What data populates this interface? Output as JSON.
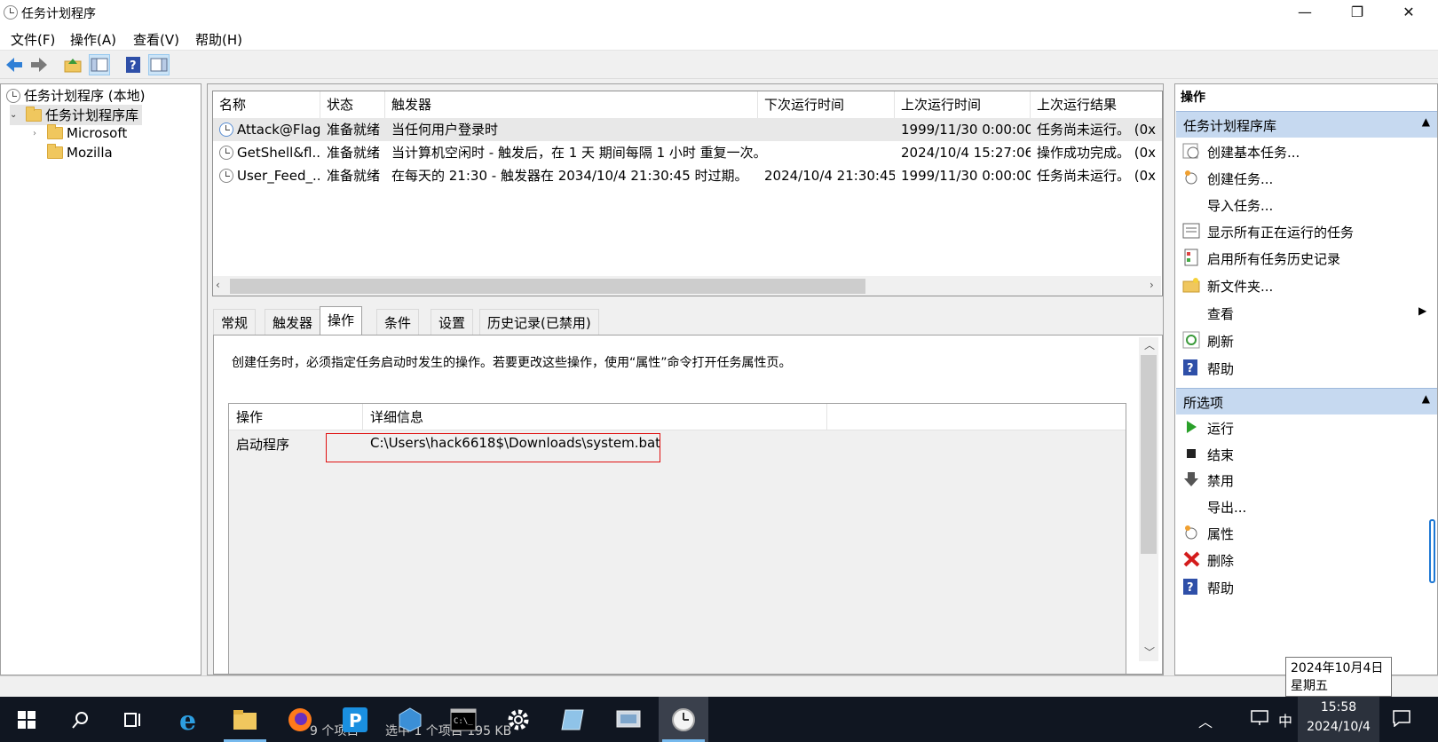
{
  "window": {
    "title": "任务计划程序",
    "minimize": "—",
    "maximize": "❐",
    "close": "✕"
  },
  "menu": [
    "文件(F)",
    "操作(A)",
    "查看(V)",
    "帮助(H)"
  ],
  "tree": {
    "root": "任务计划程序 (本地)",
    "library": "任务计划程序库",
    "children": [
      "Microsoft",
      "Mozilla"
    ]
  },
  "tasks": {
    "columns": [
      "名称",
      "状态",
      "触发器",
      "下次运行时间",
      "上次运行时间",
      "上次运行结果"
    ],
    "rows": [
      {
        "name": "Attack@Flag",
        "status": "准备就绪",
        "trigger": "当任何用户登录时",
        "next": "",
        "last": "1999/11/30 0:00:00",
        "result": "任务尚未运行。 (0x"
      },
      {
        "name": "GetShell&fl...",
        "status": "准备就绪",
        "trigger": "当计算机空闲时 - 触发后，在 1 天 期间每隔 1 小时 重复一次。",
        "next": "",
        "last": "2024/10/4 15:27:06",
        "result": "操作成功完成。 (0x"
      },
      {
        "name": "User_Feed_...",
        "status": "准备就绪",
        "trigger": "在每天的 21:30 - 触发器在 2034/10/4 21:30:45 时过期。",
        "next": "2024/10/4 21:30:45",
        "last": "1999/11/30 0:00:00",
        "result": "任务尚未运行。 (0x"
      }
    ]
  },
  "tabs": [
    "常规",
    "触发器",
    "操作",
    "条件",
    "设置",
    "历史记录(已禁用)"
  ],
  "actions_tab": {
    "description": "创建任务时，必须指定任务启动时发生的操作。若要更改这些操作，使用“属性”命令打开任务属性页。",
    "columns": [
      "操作",
      "详细信息"
    ],
    "rows": [
      {
        "action": "启动程序",
        "detail": "C:\\Users\\hack6618$\\Downloads\\system.bat"
      }
    ]
  },
  "right_pane": {
    "header": "操作",
    "section1": "任务计划程序库",
    "items1": [
      "创建基本任务...",
      "创建任务...",
      "导入任务...",
      "显示所有正在运行的任务",
      "启用所有任务历史记录",
      "新文件夹...",
      "查看",
      "刷新",
      "帮助"
    ],
    "section2": "所选项",
    "items2": [
      "运行",
      "结束",
      "禁用",
      "导出...",
      "属性",
      "删除",
      "帮助"
    ]
  },
  "status": {
    "left": "9 个项目",
    "mid": "选中 1 个项目 195 KB"
  },
  "tooltip": {
    "line1": "2024年10月4日",
    "line2": "星期五"
  },
  "clock": {
    "time": "15:58",
    "date": "2024/10/4"
  },
  "ime": "中",
  "colors": {
    "accent": "#76b9ed",
    "section": "#c6d9f0",
    "highlight_box": "#e01010"
  }
}
